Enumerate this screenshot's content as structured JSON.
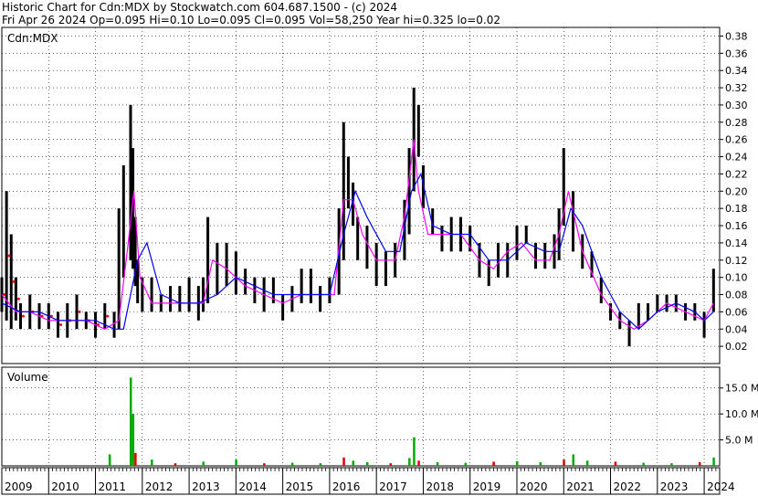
{
  "header": {
    "line1": "Historic Chart for Cdn:MDX by Stockwatch.com 604.687.1500 - (c) 2024",
    "line2": "Fri Apr 26 2024   Op=0.095  Hi=0.10  Lo=0.095  Cl=0.095  Vol=58,250  Year hi=0.325  lo=0.02"
  },
  "colors": {
    "background": "#ffffff",
    "grid": "#000000",
    "price_bar": "#000000",
    "ma_short": "#ff00ff",
    "ma_long": "#0000ff",
    "early_dots": "#ff0000",
    "volume_up": "#00aa00",
    "volume_down": "#dd0000"
  },
  "chart_data": [
    {
      "type": "line",
      "title": "Cdn:MDX",
      "ylim": [
        0,
        0.39
      ],
      "yticks": [
        "0.02",
        "0.04",
        "0.06",
        "0.08",
        "0.10",
        "0.12",
        "0.14",
        "0.16",
        "0.18",
        "0.20",
        "0.22",
        "0.24",
        "0.26",
        "0.28",
        "0.30",
        "0.32",
        "0.34",
        "0.36",
        "0.38"
      ],
      "x_labels": [
        "2009",
        "2010",
        "2011",
        "2012",
        "2013",
        "2014",
        "2015",
        "2016",
        "2017",
        "2018",
        "2019",
        "2020",
        "2021",
        "2022",
        "2023",
        "2024"
      ],
      "series": [
        {
          "style": "high-low bars",
          "x": [
            2009.0,
            2009.1,
            2009.2,
            2009.3,
            2009.4,
            2009.6,
            2009.8,
            2010.0,
            2010.2,
            2010.4,
            2010.6,
            2010.8,
            2011.0,
            2011.2,
            2011.4,
            2011.5,
            2011.6,
            2011.75,
            2011.8,
            2011.85,
            2011.9,
            2012.0,
            2012.2,
            2012.4,
            2012.6,
            2012.8,
            2013.0,
            2013.2,
            2013.3,
            2013.4,
            2013.6,
            2013.8,
            2014.0,
            2014.2,
            2014.4,
            2014.6,
            2014.8,
            2015.0,
            2015.2,
            2015.4,
            2015.6,
            2015.8,
            2016.0,
            2016.2,
            2016.3,
            2016.4,
            2016.5,
            2016.6,
            2016.8,
            2017.0,
            2017.2,
            2017.4,
            2017.6,
            2017.7,
            2017.8,
            2017.9,
            2018.0,
            2018.2,
            2018.4,
            2018.6,
            2018.8,
            2019.0,
            2019.2,
            2019.4,
            2019.6,
            2019.8,
            2020.0,
            2020.2,
            2020.4,
            2020.6,
            2020.8,
            2020.9,
            2021.0,
            2021.2,
            2021.4,
            2021.6,
            2021.8,
            2022.0,
            2022.2,
            2022.4,
            2022.6,
            2022.8,
            2023.0,
            2023.2,
            2023.4,
            2023.6,
            2023.8,
            2024.0,
            2024.2
          ],
          "y_low": [
            0.06,
            0.05,
            0.04,
            0.05,
            0.04,
            0.04,
            0.04,
            0.04,
            0.03,
            0.03,
            0.04,
            0.04,
            0.03,
            0.04,
            0.03,
            0.04,
            0.1,
            0.12,
            0.11,
            0.09,
            0.07,
            0.06,
            0.06,
            0.06,
            0.06,
            0.06,
            0.06,
            0.05,
            0.06,
            0.07,
            0.08,
            0.09,
            0.08,
            0.08,
            0.07,
            0.06,
            0.07,
            0.05,
            0.06,
            0.07,
            0.07,
            0.06,
            0.07,
            0.08,
            0.12,
            0.18,
            0.16,
            0.12,
            0.11,
            0.09,
            0.09,
            0.1,
            0.12,
            0.15,
            0.2,
            0.24,
            0.18,
            0.15,
            0.13,
            0.13,
            0.13,
            0.13,
            0.1,
            0.09,
            0.1,
            0.1,
            0.12,
            0.14,
            0.11,
            0.11,
            0.11,
            0.12,
            0.16,
            0.13,
            0.11,
            0.1,
            0.07,
            0.05,
            0.04,
            0.02,
            0.04,
            0.05,
            0.06,
            0.06,
            0.06,
            0.05,
            0.05,
            0.03,
            0.06
          ],
          "y_high": [
            0.1,
            0.2,
            0.15,
            0.1,
            0.07,
            0.08,
            0.07,
            0.07,
            0.06,
            0.07,
            0.08,
            0.06,
            0.06,
            0.07,
            0.06,
            0.18,
            0.23,
            0.3,
            0.25,
            0.17,
            0.12,
            0.1,
            0.1,
            0.08,
            0.09,
            0.09,
            0.1,
            0.09,
            0.1,
            0.17,
            0.14,
            0.14,
            0.13,
            0.11,
            0.1,
            0.1,
            0.1,
            0.08,
            0.09,
            0.11,
            0.11,
            0.09,
            0.1,
            0.18,
            0.28,
            0.24,
            0.21,
            0.17,
            0.16,
            0.14,
            0.13,
            0.14,
            0.19,
            0.25,
            0.32,
            0.3,
            0.23,
            0.18,
            0.16,
            0.17,
            0.17,
            0.16,
            0.14,
            0.12,
            0.14,
            0.14,
            0.16,
            0.16,
            0.14,
            0.14,
            0.15,
            0.18,
            0.25,
            0.2,
            0.15,
            0.13,
            0.1,
            0.07,
            0.06,
            0.05,
            0.07,
            0.07,
            0.08,
            0.08,
            0.08,
            0.07,
            0.07,
            0.06,
            0.11
          ]
        },
        {
          "style": "moving average (magenta)",
          "x": [
            2009.0,
            2009.3,
            2009.6,
            2010.0,
            2010.4,
            2010.8,
            2011.2,
            2011.5,
            2011.7,
            2011.82,
            2011.95,
            2012.2,
            2012.6,
            2013.0,
            2013.3,
            2013.5,
            2013.8,
            2014.2,
            2014.6,
            2015.0,
            2015.4,
            2015.8,
            2016.1,
            2016.3,
            2016.5,
            2016.7,
            2017.0,
            2017.4,
            2017.6,
            2017.8,
            2017.9,
            2018.1,
            2018.4,
            2018.8,
            2019.2,
            2019.5,
            2019.8,
            2020.1,
            2020.4,
            2020.7,
            2020.9,
            2021.1,
            2021.4,
            2021.8,
            2022.2,
            2022.5,
            2022.8,
            2023.2,
            2023.6,
            2024.0,
            2024.2
          ],
          "y": [
            0.08,
            0.06,
            0.06,
            0.05,
            0.05,
            0.05,
            0.04,
            0.05,
            0.14,
            0.2,
            0.1,
            0.07,
            0.07,
            0.07,
            0.07,
            0.12,
            0.11,
            0.09,
            0.08,
            0.07,
            0.08,
            0.08,
            0.08,
            0.19,
            0.19,
            0.15,
            0.12,
            0.12,
            0.17,
            0.26,
            0.2,
            0.15,
            0.15,
            0.15,
            0.12,
            0.11,
            0.13,
            0.14,
            0.12,
            0.12,
            0.15,
            0.2,
            0.13,
            0.08,
            0.05,
            0.04,
            0.05,
            0.07,
            0.06,
            0.05,
            0.07
          ]
        },
        {
          "style": "moving average (blue)",
          "x": [
            2009.0,
            2009.4,
            2009.8,
            2010.2,
            2010.6,
            2011.0,
            2011.4,
            2011.6,
            2011.9,
            2012.1,
            2012.4,
            2012.8,
            2013.2,
            2013.6,
            2014.0,
            2014.4,
            2014.8,
            2015.2,
            2015.6,
            2016.0,
            2016.3,
            2016.55,
            2016.8,
            2017.2,
            2017.5,
            2017.75,
            2017.95,
            2018.2,
            2018.6,
            2019.0,
            2019.4,
            2019.8,
            2020.2,
            2020.6,
            2020.9,
            2021.15,
            2021.4,
            2021.8,
            2022.2,
            2022.6,
            2023.0,
            2023.4,
            2023.8,
            2024.0,
            2024.2
          ],
          "y": [
            0.07,
            0.06,
            0.06,
            0.05,
            0.05,
            0.05,
            0.04,
            0.04,
            0.12,
            0.14,
            0.08,
            0.07,
            0.07,
            0.08,
            0.1,
            0.09,
            0.08,
            0.08,
            0.08,
            0.08,
            0.15,
            0.2,
            0.17,
            0.13,
            0.13,
            0.2,
            0.22,
            0.16,
            0.15,
            0.15,
            0.12,
            0.12,
            0.14,
            0.13,
            0.13,
            0.18,
            0.16,
            0.1,
            0.06,
            0.04,
            0.06,
            0.07,
            0.06,
            0.05,
            0.06
          ]
        }
      ]
    },
    {
      "type": "bar",
      "title": "Volume",
      "ylim": [
        0,
        19
      ],
      "yticks": [
        "5.0 M",
        "10.0 M",
        "15.0 M"
      ],
      "x": [
        2011.75,
        2011.8,
        2011.85,
        2011.3,
        2012.2,
        2012.7,
        2013.3,
        2014.0,
        2014.6,
        2015.2,
        2015.8,
        2016.3,
        2016.5,
        2016.8,
        2017.3,
        2017.7,
        2017.8,
        2017.9,
        2018.3,
        2018.9,
        2019.5,
        2020.0,
        2020.5,
        2021.0,
        2021.2,
        2021.5,
        2022.1,
        2022.7,
        2023.3,
        2023.9,
        2024.2
      ],
      "values": [
        17,
        10,
        2.5,
        2.2,
        1.2,
        0.5,
        0.8,
        1.2,
        0.5,
        0.6,
        0.5,
        1.6,
        1,
        0.7,
        0.5,
        1.5,
        5.5,
        1,
        0.7,
        0.6,
        0.8,
        0.9,
        0.7,
        1.2,
        2.2,
        1,
        0.8,
        0.6,
        0.5,
        0.7,
        1.6
      ]
    }
  ]
}
